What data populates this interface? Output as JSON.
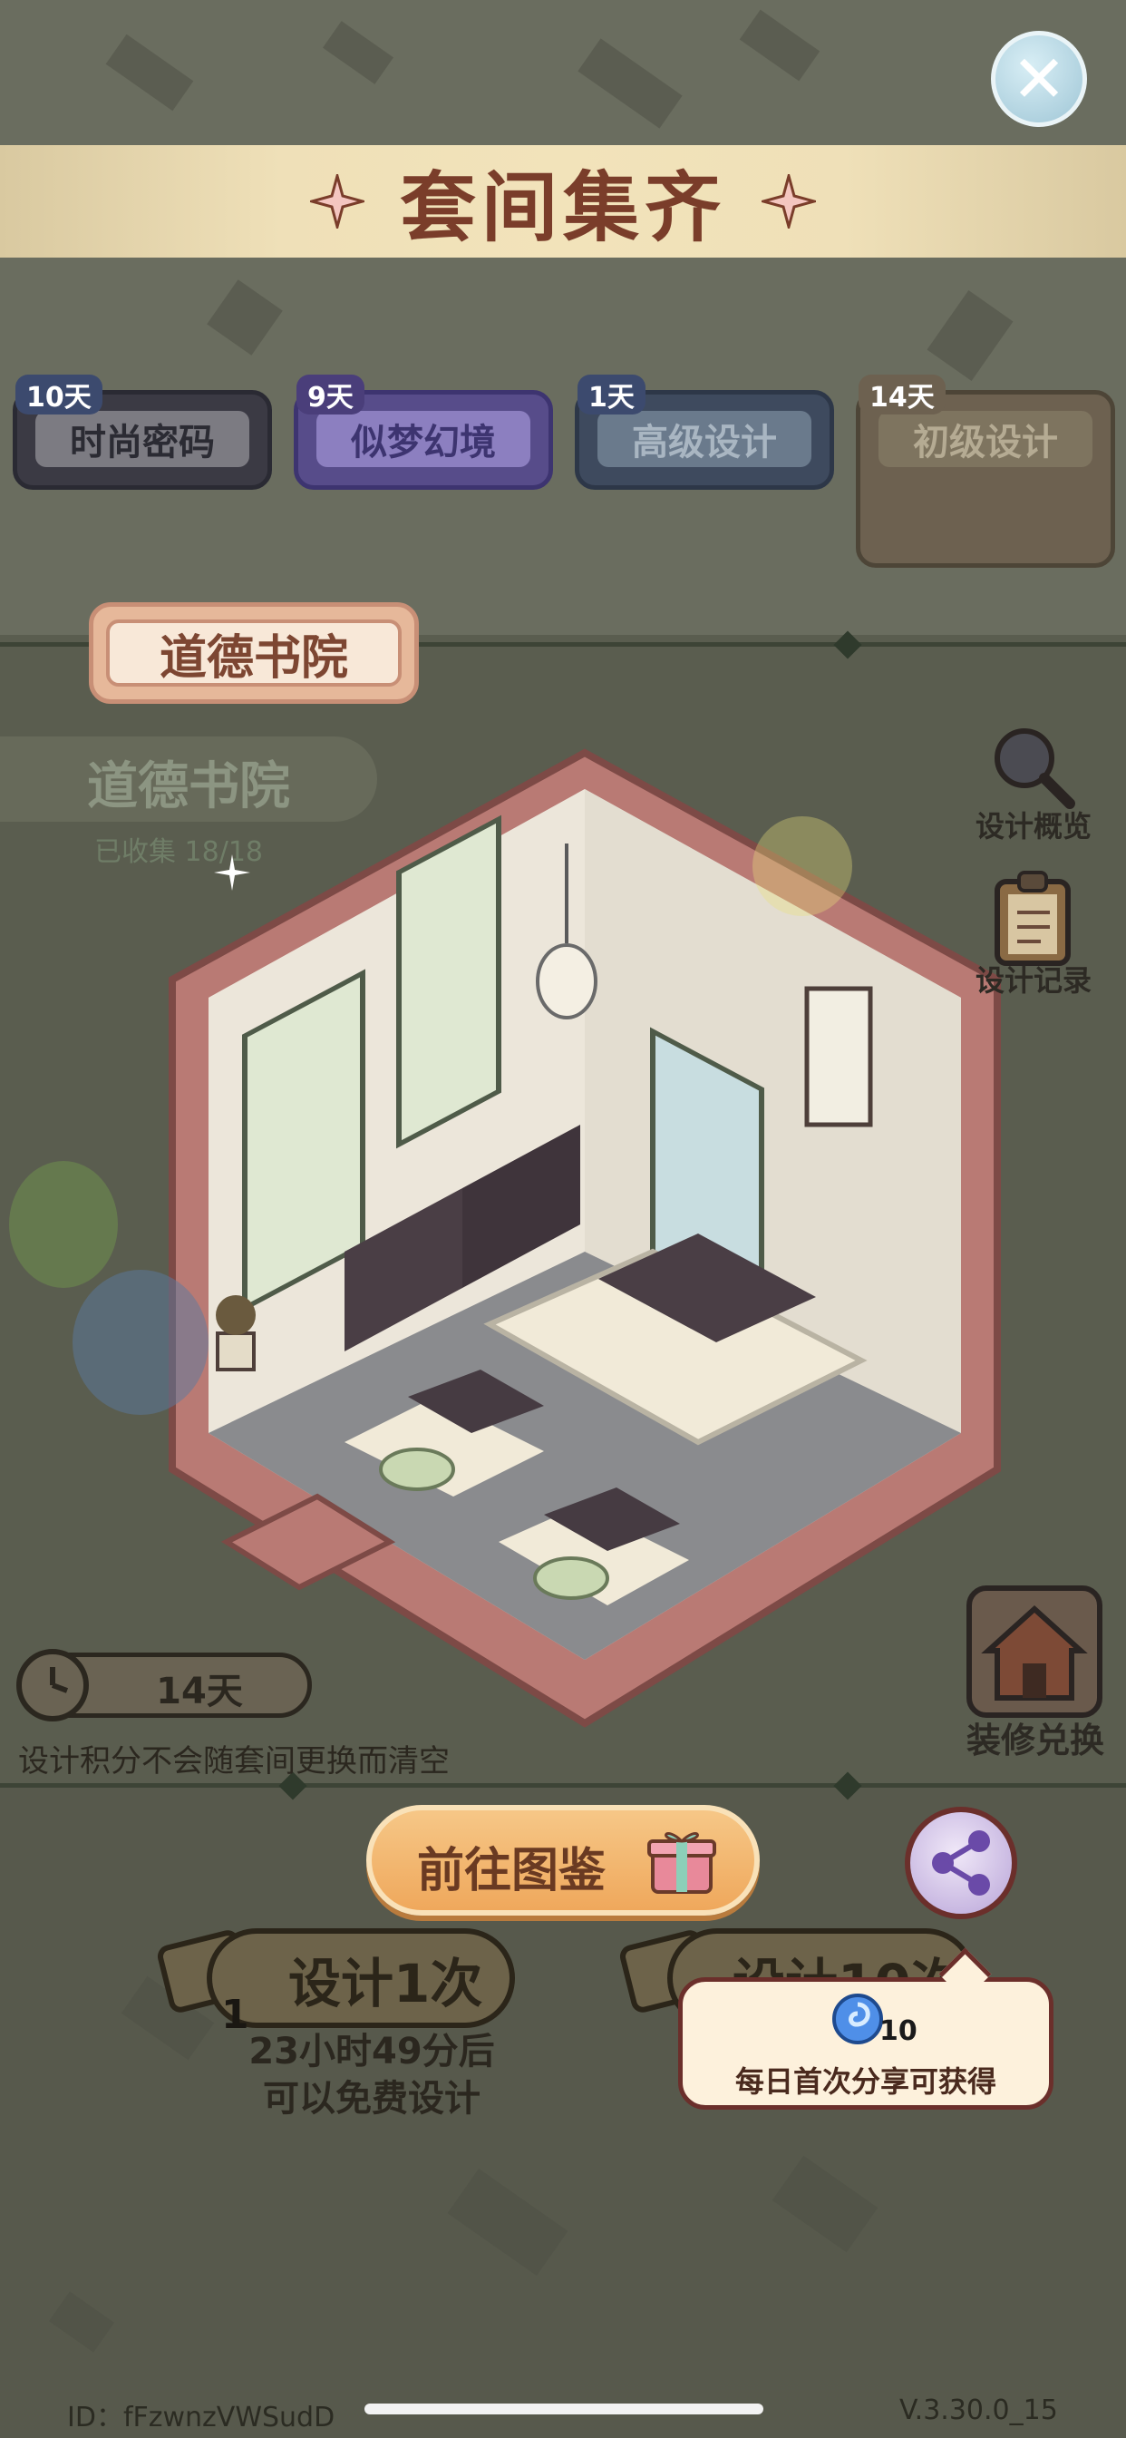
{
  "header": {
    "title": "套间集齐",
    "close_label": "close"
  },
  "tabs": [
    {
      "label": "时尚密码",
      "badge": "10天"
    },
    {
      "label": "似梦幻境",
      "badge": "9天"
    },
    {
      "label": "高级设计",
      "badge": "1天"
    },
    {
      "label": "初级设计",
      "badge": "14天"
    }
  ],
  "room": {
    "label": "道德书院",
    "name": "道德书院",
    "collected": "已收集 18/18"
  },
  "side_buttons": {
    "overview": "设计概览",
    "records": "设计记录",
    "exchange": "装修兑换"
  },
  "timer": {
    "days": "14天",
    "note": "设计积分不会随套间更换而清空"
  },
  "actions": {
    "goto_album": "前往图鉴",
    "design_once": "设计1次",
    "design_ten": "设计10次",
    "design_once_cost": "1",
    "free_line1": "23小时49分后",
    "free_line2": "可以免费设计"
  },
  "share_tooltip": {
    "count": "10",
    "text": "每日首次分享可获得"
  },
  "footer": {
    "id": "ID：fFzwnzVWSudD",
    "version": "V.3.30.0_15"
  },
  "colors": {
    "title": "#7a3d2a",
    "banner": "#efe0b8",
    "room_frame": "#b97a74",
    "button_orange": "#efa85c"
  }
}
